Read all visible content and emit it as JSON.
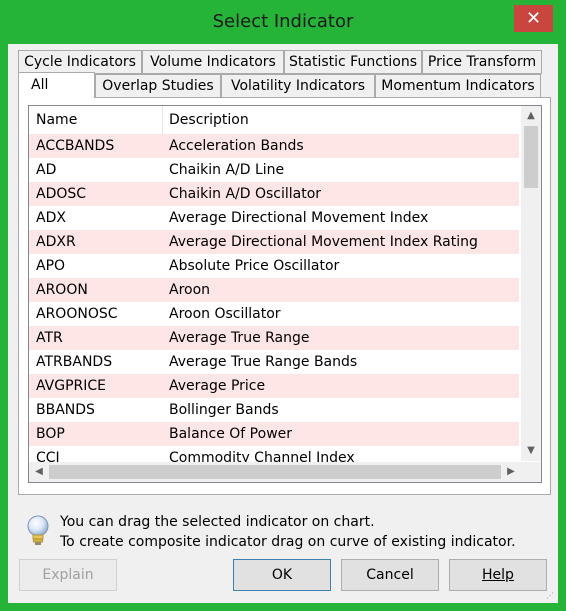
{
  "window": {
    "title": "Select Indicator",
    "close_glyph": "✕"
  },
  "tabs_row1": [
    "Cycle Indicators",
    "Volume Indicators",
    "Statistic Functions",
    "Price Transform"
  ],
  "tabs_row2": [
    "All",
    "Overlap Studies",
    "Volatility Indicators",
    "Momentum Indicators"
  ],
  "active_tab": "All",
  "list": {
    "columns": [
      "Name",
      "Description"
    ],
    "rows": [
      [
        "ACCBANDS",
        "Acceleration Bands"
      ],
      [
        "AD",
        "Chaikin A/D Line"
      ],
      [
        "ADOSC",
        "Chaikin A/D Oscillator"
      ],
      [
        "ADX",
        "Average Directional Movement Index"
      ],
      [
        "ADXR",
        "Average Directional Movement Index Rating"
      ],
      [
        "APO",
        "Absolute Price Oscillator"
      ],
      [
        "AROON",
        "Aroon"
      ],
      [
        "AROONOSC",
        "Aroon Oscillator"
      ],
      [
        "ATR",
        "Average True Range"
      ],
      [
        "ATRBANDS",
        "Average True Range Bands"
      ],
      [
        "AVGPRICE",
        "Average Price"
      ],
      [
        "BBANDS",
        "Bollinger Bands"
      ],
      [
        "BOP",
        "Balance Of Power"
      ],
      [
        "CCI",
        "Commodity Channel Index"
      ]
    ]
  },
  "hint": {
    "icon": "lightbulb-icon",
    "line1": "You can drag the selected indicator on chart.",
    "line2": "To create composite indicator drag on curve of existing indicator."
  },
  "buttons": {
    "explain": "Explain",
    "ok": "OK",
    "cancel": "Cancel",
    "help": "Help"
  },
  "colors": {
    "title_bar": "#25b338",
    "row_alt": "#ffe6e6",
    "close": "#c9463f"
  }
}
